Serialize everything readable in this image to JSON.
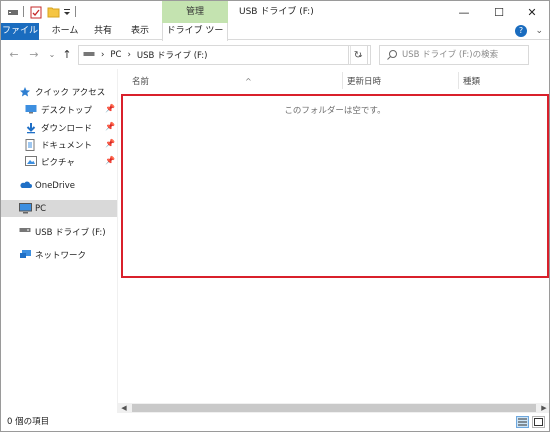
{
  "title_bar": {
    "contextual_tab_label": "管理",
    "window_title": "USB ドライブ (F:)",
    "minimize_glyph": "—",
    "maximize_glyph": "☐",
    "close_glyph": "✕"
  },
  "ribbon": {
    "tabs": [
      {
        "label": "ファイル"
      },
      {
        "label": "ホーム"
      },
      {
        "label": "共有"
      },
      {
        "label": "表示"
      },
      {
        "label": "ドライブ ツール"
      }
    ],
    "expand_glyph": "⌄",
    "help_glyph": "?"
  },
  "nav_buttons": {
    "back_glyph": "←",
    "forward_glyph": "→",
    "recent_glyph": "⌄",
    "up_glyph": "↑"
  },
  "address_bar": {
    "separator": "›",
    "path": [
      "PC",
      "USB ドライブ (F:)"
    ],
    "dropdown_glyph": "⌄",
    "refresh_glyph": "↻"
  },
  "search": {
    "placeholder": "USB ドライブ (F:)の検索"
  },
  "nav_pane": {
    "quick_access": {
      "label": "クイック アクセス",
      "items": [
        {
          "label": "デスクトップ",
          "pinned": true
        },
        {
          "label": "ダウンロード",
          "pinned": true
        },
        {
          "label": "ドキュメント",
          "pinned": true
        },
        {
          "label": "ピクチャ",
          "pinned": true
        }
      ],
      "pin_glyph": "📌"
    },
    "onedrive_label": "OneDrive",
    "pc_label": "PC",
    "usb_label": "USB ドライブ (F:)",
    "network_label": "ネットワーク"
  },
  "content": {
    "columns": [
      {
        "label": "名前"
      },
      {
        "label": "更新日時"
      },
      {
        "label": "種類"
      }
    ],
    "sort_glyph": "^",
    "empty_message": "このフォルダーは空です。"
  },
  "status_bar": {
    "item_count": "0 個の項目"
  },
  "colors": {
    "file_tab": "#1a6cbf",
    "contextual_tab": "#c4e3b0",
    "highlight_border": "#d9202b",
    "selected_nav": "#d9d9d9"
  }
}
